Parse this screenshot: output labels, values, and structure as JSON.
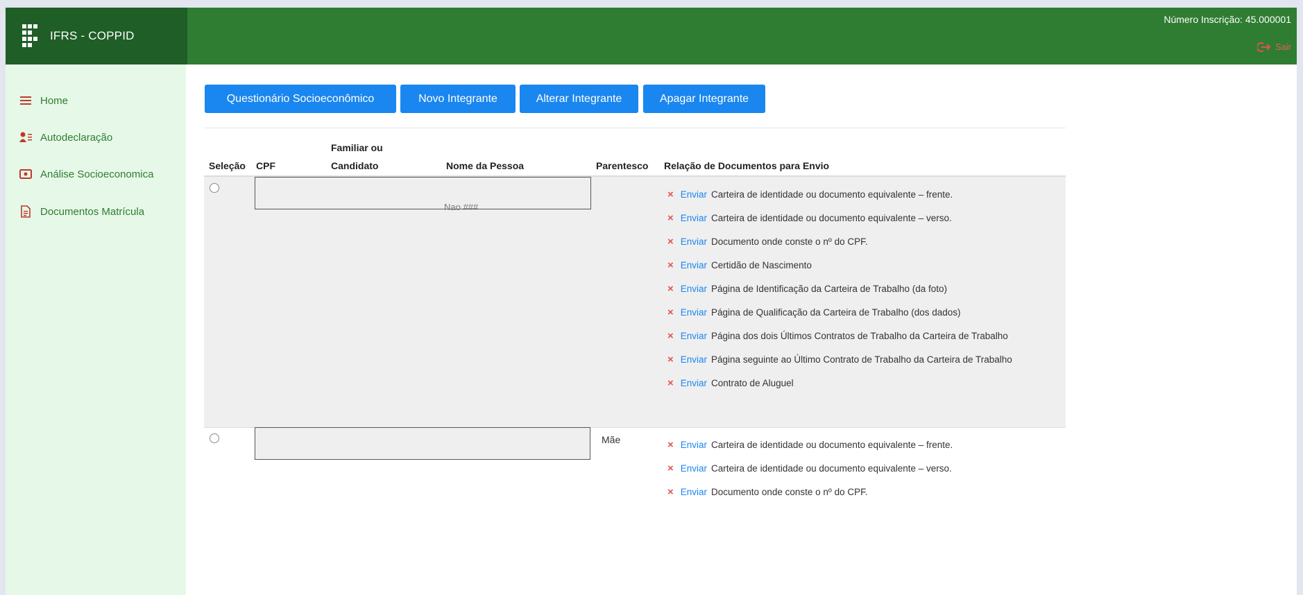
{
  "brand": {
    "name": "IFRS - COPPID"
  },
  "header": {
    "registration": "Número Inscrição: 45.000001",
    "logout_label": "Sair"
  },
  "sidebar": {
    "items": [
      {
        "label": "Home",
        "icon": "menu-icon"
      },
      {
        "label": "Autodeclaração",
        "icon": "user-list-icon"
      },
      {
        "label": "Análise Socioeconomica",
        "icon": "camera-icon"
      },
      {
        "label": "Documentos Matrícula",
        "icon": "document-icon"
      }
    ]
  },
  "toolbar": {
    "questionnaire": "Questionário Socioeconômico",
    "new_member": "Novo Integrante",
    "edit_member": "Alterar Integrante",
    "delete_member": "Apagar Integrante"
  },
  "table": {
    "headers": {
      "selection": "Seleção",
      "cpf": "CPF",
      "family_line1": "Familiar ou",
      "family_line2": "Candidato",
      "name": "Nome da Pessoa",
      "relationship": "Parentesco",
      "documents": "Relação de Documentos para Envio"
    },
    "send_label": "Enviar",
    "remove_symbol": "×",
    "rows": [
      {
        "relationship": "",
        "ghost_text": "Nao ###",
        "docs": [
          "Carteira de identidade ou documento equivalente – frente.",
          "Carteira de identidade ou documento equivalente – verso.",
          "Documento onde conste o nº do CPF.",
          "Certidão de Nascimento",
          "Página de Identificação da Carteira de Trabalho (da foto)",
          "Página de Qualificação da Carteira de Trabalho (dos dados)",
          "Página dos dois Últimos Contratos de Trabalho da Carteira de Trabalho",
          "Página seguinte ao Último Contrato de Trabalho da Carteira de Trabalho",
          "Contrato de Aluguel"
        ]
      },
      {
        "relationship": "Mãe",
        "docs": [
          "Carteira de identidade ou documento equivalente – frente.",
          "Carteira de identidade ou documento equivalente – verso.",
          "Documento onde conste o nº do CPF."
        ]
      }
    ]
  },
  "colors": {
    "header_green": "#2f7d32",
    "brand_green": "#1f5e27",
    "sidebar_bg": "#e6f8e7",
    "button_blue": "#1a86f0",
    "remove_red": "#e05353"
  }
}
